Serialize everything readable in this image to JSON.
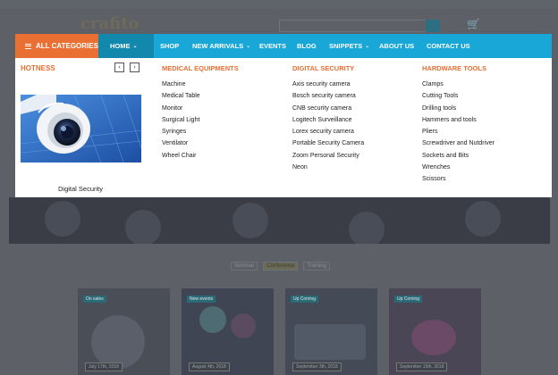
{
  "site": {
    "logo_text": "crafito"
  },
  "category_button": {
    "label": "ALL CATEGORIES"
  },
  "nav": {
    "items": [
      {
        "label": "HOME",
        "caret": "⌄",
        "active": true
      },
      {
        "label": "SHOP",
        "caret": "",
        "active": false
      },
      {
        "label": "NEW ARRIVALS",
        "caret": "⌄",
        "active": false
      },
      {
        "label": "EVENTS",
        "caret": "",
        "active": false
      },
      {
        "label": "BLOG",
        "caret": "",
        "active": false
      },
      {
        "label": "SNIPPETS",
        "caret": "⌄",
        "active": false
      },
      {
        "label": "ABOUT US",
        "caret": "",
        "active": false
      },
      {
        "label": "CONTACT US",
        "caret": "",
        "active": false
      }
    ]
  },
  "mega_menu": {
    "hot": {
      "title": "HOTNESS",
      "prev_icon": "chevron-left-icon",
      "next_icon": "chevron-right-icon",
      "caption": "Digital Security"
    },
    "columns": [
      {
        "title": "MEDICAL EQUIPMENTS",
        "items": [
          "Machine",
          "Medical Table",
          "Monitor",
          "Surgical Light",
          "Syringes",
          "Ventilator",
          "Wheel Chair"
        ]
      },
      {
        "title": "DIGITAL SECURITY",
        "items": [
          "Axis security camera",
          "Bosch security camera",
          "CNB security camera",
          "Logitech Surveillance",
          "Lorex security camera",
          "Portable Security Camera",
          "Zoom Personal Security",
          "Neon"
        ]
      },
      {
        "title": "HARDWARE TOOLS",
        "items": [
          "Clamps",
          "Cutting Tools",
          "Drilling tools",
          "Hammers and tools",
          "Pliers",
          "Screwdriver and Nutdriver",
          "Sockets and Bits",
          "Wrenches",
          "Scissors"
        ]
      }
    ]
  },
  "background": {
    "filters": [
      "Seminar",
      "Conference",
      "Training"
    ],
    "cards": [
      {
        "tag": "On sales",
        "date": "July 17th, 2018"
      },
      {
        "tag": "New events",
        "date": "August 4th, 2018"
      },
      {
        "tag": "Up Coming",
        "date": "September 3th, 2018"
      },
      {
        "tag": "Up Coming",
        "date": "September 15th, 2018"
      }
    ]
  },
  "colors": {
    "accent": "#e96f33",
    "nav": "#18a7d6",
    "nav_active": "#1288ad"
  }
}
